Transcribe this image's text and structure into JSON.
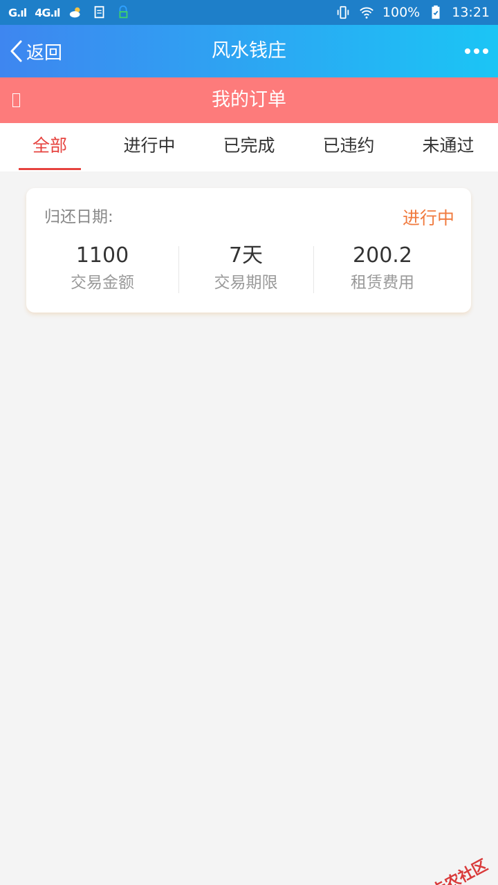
{
  "status_bar": {
    "signal1": "G.ıl",
    "signal2": "4G.ıl",
    "battery": "100%",
    "time": "13:21"
  },
  "nav": {
    "back_label": "返回",
    "title": "风水钱庄"
  },
  "sub_header": {
    "title": "我的订单"
  },
  "tabs": [
    {
      "label": "全部",
      "active": true
    },
    {
      "label": "进行中"
    },
    {
      "label": "已完成"
    },
    {
      "label": "已违约"
    },
    {
      "label": "未通过"
    }
  ],
  "order": {
    "return_date_label": "归还日期:",
    "status": "进行中",
    "stats": [
      {
        "value": "1100",
        "label": "交易金额"
      },
      {
        "value": "7天",
        "label": "交易期限"
      },
      {
        "value": "200.2",
        "label": "租赁费用"
      }
    ]
  },
  "watermark": {
    "text": "卡农社区"
  },
  "colors": {
    "nav_gradient_start": "#3e86f0",
    "nav_gradient_end": "#1bc5f5",
    "sub_header_bg": "#fd7b7b",
    "active_tab": "#e6433f",
    "status_orange": "#f07a3e"
  }
}
